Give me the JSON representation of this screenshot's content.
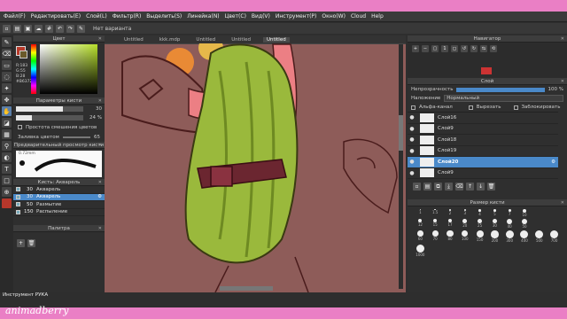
{
  "menu": [
    "Файл(F)",
    "Редактировать(E)",
    "Слой(L)",
    "Фильтр(R)",
    "Выделить(S)",
    "Линейка(N)",
    "Цвет(C)",
    "Вид(V)",
    "Инструмент(P)",
    "Окно(W)",
    "Cloud",
    "Help"
  ],
  "toolbar": {
    "variant_label": "Нет варианта"
  },
  "tabs": [
    "Untitled",
    "kkk.mdp",
    "Untitled",
    "Untitled",
    "Untitled"
  ],
  "color_panel": {
    "title": "Цвет",
    "rgb": [
      "R:183",
      "G:55",
      "B:28",
      "#B6372B"
    ]
  },
  "brush_params": {
    "title": "Параметры кисти",
    "size": "30",
    "opacity": "24 %",
    "opacity_fraction": 0.24,
    "size_fraction": 0.7,
    "stabilizer_label": "Простота смешения цветов",
    "fill_label": "Заливка цветом",
    "fill_value": "65"
  },
  "brush_preview": {
    "title": "Предварительный просмотр кисти",
    "size": "0.72mm"
  },
  "brush_list": {
    "title": "Кисть: Акварель",
    "items": [
      {
        "num": "30",
        "label": "Акварель",
        "selected": false
      },
      {
        "num": "30",
        "label": "Акварель",
        "selected": true
      },
      {
        "num": "50",
        "label": "Размытие",
        "selected": false
      },
      {
        "num": "150",
        "label": "Распыление",
        "selected": false
      }
    ]
  },
  "palette": {
    "title": "Палитра"
  },
  "status": {
    "tool": "Инструмент РУКА"
  },
  "watermark": "animadberry",
  "navigator": {
    "title": "Навигатор"
  },
  "layers_panel": {
    "title": "Слой",
    "opacity_label": "Непрозрачность",
    "opacity_value": "100 %",
    "blend_label": "Наложение",
    "blend_value": "Нормальный",
    "alpha_label": "Альфа-канал",
    "clip_label": "Вырезать",
    "lock_label": "Заблокировать",
    "layers": [
      {
        "name": "Слой16",
        "selected": false
      },
      {
        "name": "Слой9",
        "selected": false
      },
      {
        "name": "Слой18",
        "selected": false
      },
      {
        "name": "Слой19",
        "selected": false
      },
      {
        "name": "Слой20",
        "selected": true
      },
      {
        "name": "Слой9",
        "selected": false
      }
    ]
  },
  "brush_size": {
    "title": "Размер кисти",
    "sizes": [
      "1",
      "1.5",
      "2",
      "3",
      "4",
      "5",
      "7",
      "10",
      "",
      "",
      "12",
      "15",
      "17",
      "20",
      "25",
      "30",
      "40",
      "50",
      "",
      "",
      "60",
      "70",
      "80",
      "100",
      "150",
      "200",
      "300",
      "400",
      "500",
      "700",
      "1000"
    ]
  },
  "colors": {
    "accent": "#4a89c9",
    "canvas_bg": "#8e5c59",
    "border": "#ea7fc5"
  }
}
